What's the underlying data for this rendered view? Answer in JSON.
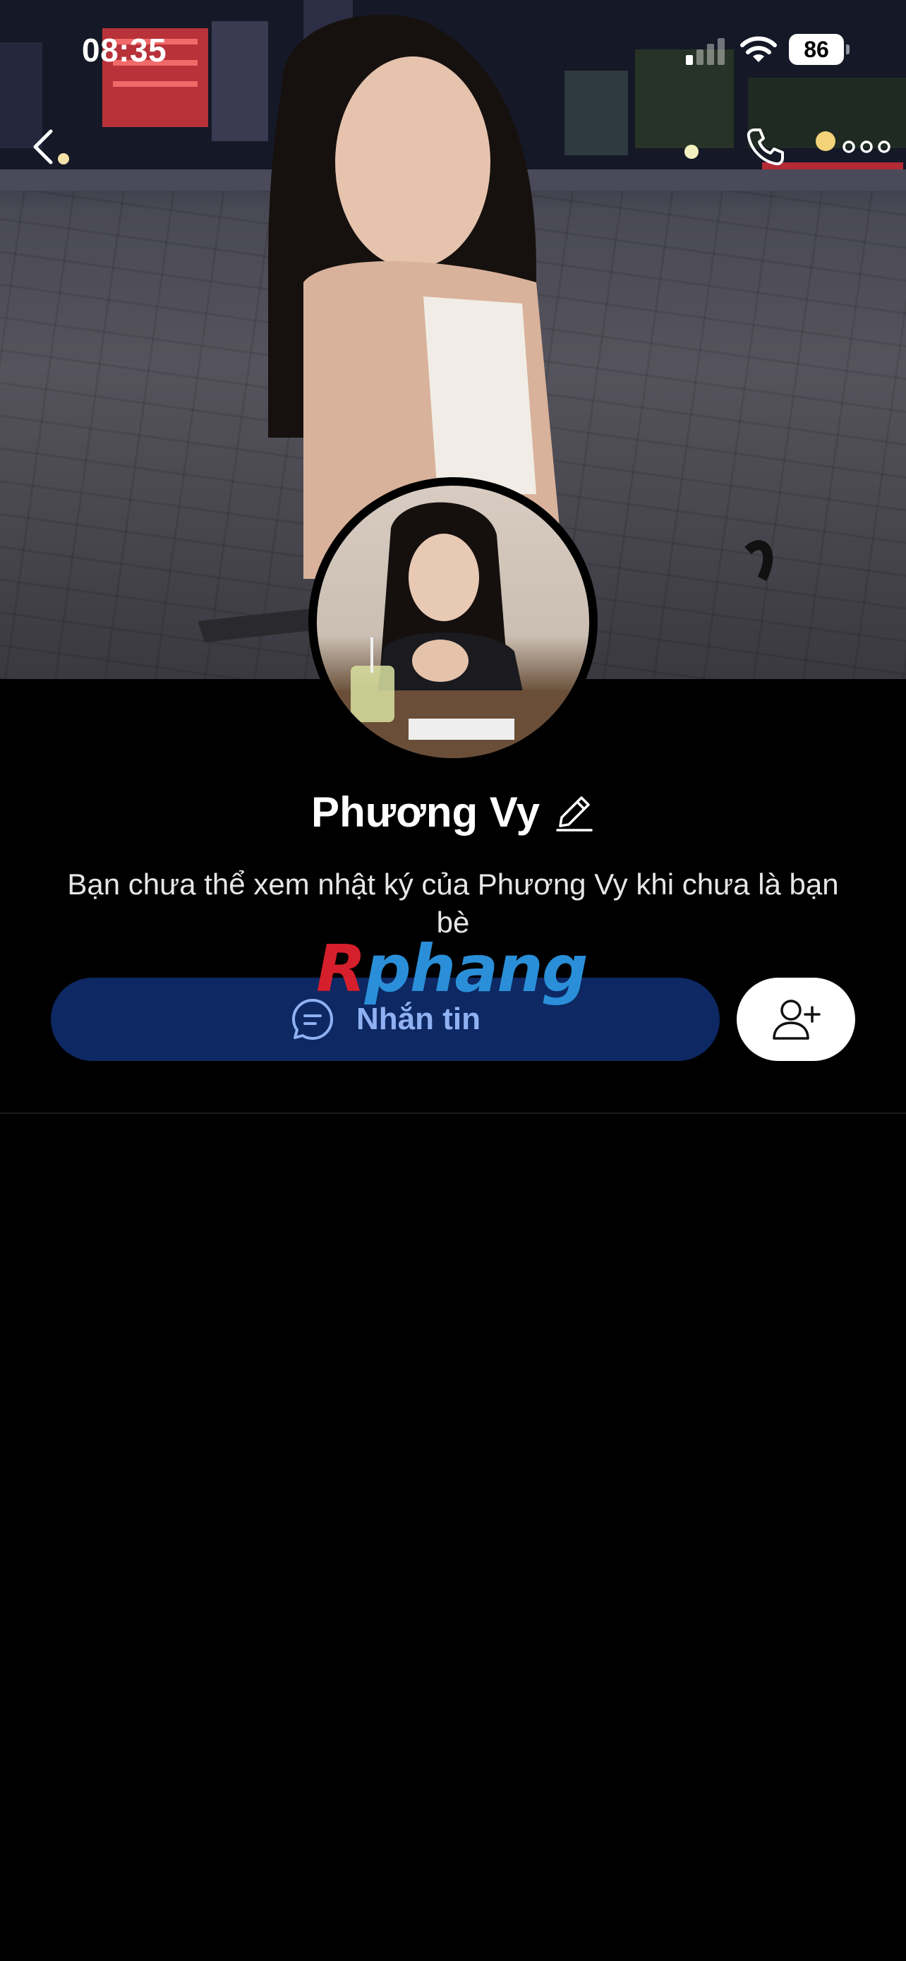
{
  "status_bar": {
    "time": "08:35",
    "battery_level": "86",
    "signal_icon": "cellular-signal-icon",
    "wifi_icon": "wifi-icon"
  },
  "nav": {
    "back_icon": "chevron-left-icon",
    "call_icon": "phone-icon",
    "more_icon": "more-dots-icon"
  },
  "profile": {
    "name": "Phương Vy",
    "edit_icon": "pencil-icon",
    "info_text": "Bạn chưa thể xem nhật ký của Phương Vy khi chưa là bạn bè"
  },
  "actions": {
    "message_label": "Nhắn tin",
    "message_icon": "chat-bubble-icon",
    "add_friend_icon": "add-user-icon"
  },
  "watermark": {
    "first_letter": "R",
    "rest": "phang"
  },
  "colors": {
    "background": "#000000",
    "message_button_bg": "#0d2862",
    "message_button_text": "#8fb1f2",
    "add_friend_bg": "#ffffff",
    "watermark_red": "#d61f2c",
    "watermark_blue": "#2a8fd8"
  }
}
